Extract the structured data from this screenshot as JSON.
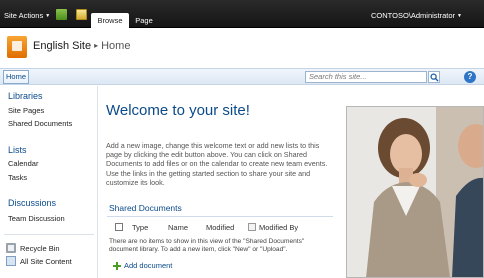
{
  "ribbon": {
    "site_actions": "Site Actions",
    "tabs": [
      "Browse",
      "Page"
    ],
    "user": "CONTOSO\\Administrator"
  },
  "header": {
    "site_title": "English Site",
    "page_name": "Home"
  },
  "topnav": {
    "home": "Home",
    "search_placeholder": "Search this site..."
  },
  "quicklaunch": {
    "libraries": {
      "heading": "Libraries",
      "items": [
        "Site Pages",
        "Shared Documents"
      ]
    },
    "lists": {
      "heading": "Lists",
      "items": [
        "Calendar",
        "Tasks"
      ]
    },
    "discussions": {
      "heading": "Discussions",
      "items": [
        "Team Discussion"
      ]
    },
    "bottom": [
      "Recycle Bin",
      "All Site Content"
    ]
  },
  "main": {
    "welcome_title": "Welcome to your site!",
    "welcome_text": "Add a new image, change this welcome text or add new lists to this page by clicking the edit button above. You can click on Shared Documents to add files or on the calendar to create new team events. Use the links in the getting started section to share your site and customize its look.",
    "shared_docs": {
      "title": "Shared Documents",
      "columns": [
        "Type",
        "Name",
        "Modified",
        "Modified By"
      ],
      "empty_message": "There are no items to show in this view of the \"Shared Documents\" document library. To add a new item, click \"New\" or \"Upload\".",
      "add_label": "Add document"
    }
  },
  "colors": {
    "link_blue": "#0b4a8a",
    "ribbon_dark": "#1e1e1e"
  },
  "icons": [
    "navigate-up-icon",
    "edit-page-icon",
    "site-logo-icon",
    "search-icon",
    "help-icon",
    "recycle-bin-icon",
    "all-site-content-icon",
    "add-icon"
  ]
}
